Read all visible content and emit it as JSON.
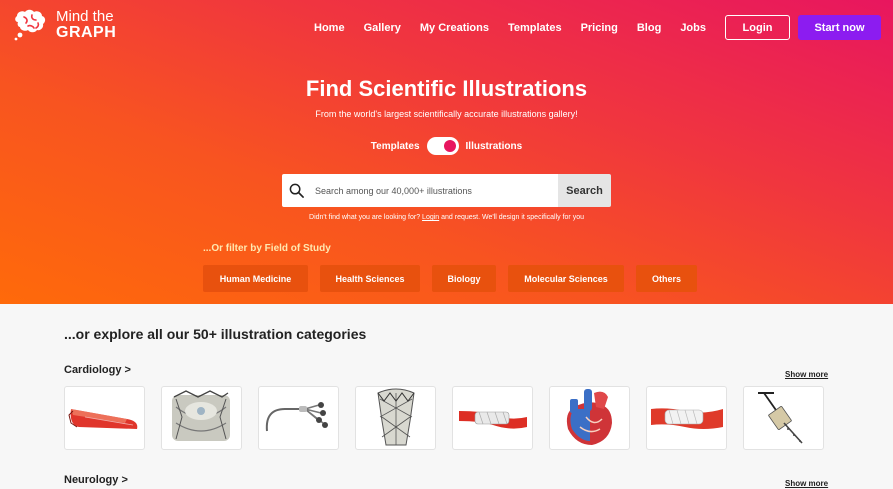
{
  "brand": {
    "line1": "Mind the",
    "line2": "GRAPH",
    "icon": "brain-logo-icon"
  },
  "nav": {
    "links": [
      "Home",
      "Gallery",
      "My Creations",
      "Templates",
      "Pricing",
      "Blog",
      "Jobs"
    ],
    "login": "Login",
    "start": "Start now"
  },
  "hero": {
    "title": "Find Scientific Illustrations",
    "subtitle": "From the world's largest scientifically accurate illustrations gallery!",
    "toggle_left": "Templates",
    "toggle_right": "Illustrations",
    "toggle_state": "Illustrations"
  },
  "search": {
    "placeholder": "Search among our 40,000+ illustrations",
    "button": "Search",
    "icon": "search-icon"
  },
  "hint": {
    "before": "Didn't find what you are looking for?",
    "link": "Login",
    "after": "and request. We'll design it specifically for you"
  },
  "filters": {
    "title": "...Or filter by Field of Study",
    "chips": [
      "Human Medicine",
      "Health Sciences",
      "Biology",
      "Molecular Sciences",
      "Others"
    ]
  },
  "explore": {
    "title": "...or explore all our 50+ illustration categories"
  },
  "categories": [
    {
      "title": "Cardiology >",
      "show_more": "Show more",
      "thumbs": [
        "stent-catheter-illustration",
        "heart-valve-illustration",
        "catheter-wires-illustration",
        "mesh-valve-illustration",
        "stent-illustration",
        "heart-anatomy-illustration",
        "stent-balloon-illustration",
        "surgical-tool-illustration"
      ]
    },
    {
      "title": "Neurology >",
      "show_more": "Show more"
    }
  ],
  "colors": {
    "accent": "#e8165f",
    "start_button": "#8c1cf0",
    "chip": "#e8510e"
  }
}
